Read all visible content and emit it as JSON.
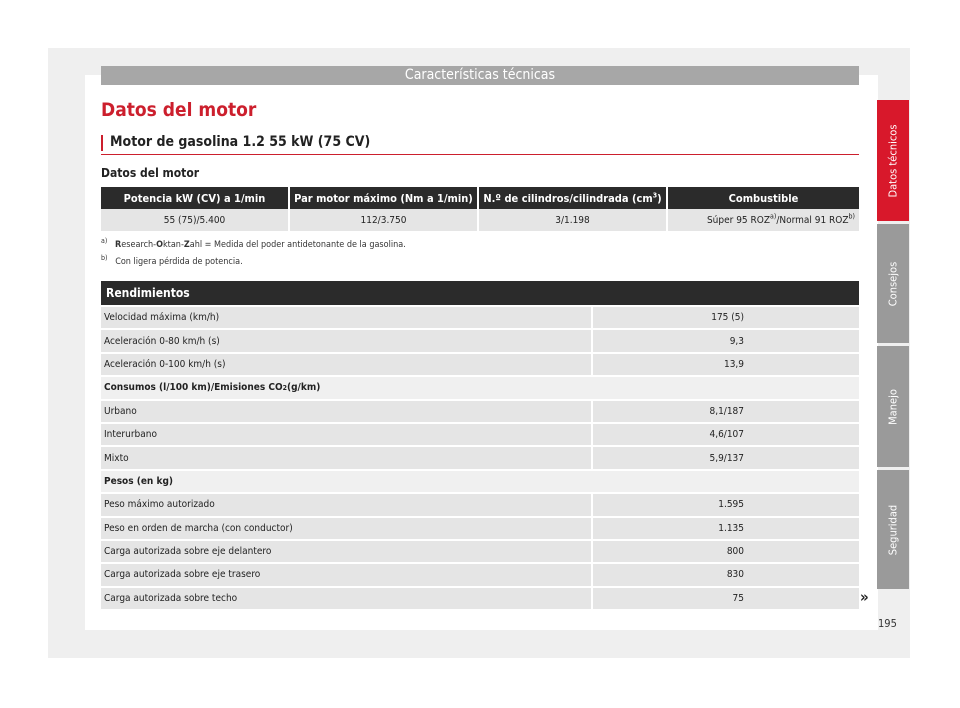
{
  "header": {
    "title": "Características técnicas"
  },
  "section_title": "Datos del motor",
  "subsection_title": "Motor de gasolina 1.2 55 kW (75 CV)",
  "engine_label": "Datos del motor",
  "engine_table": {
    "headers": [
      "Potencia kW (CV) a 1/min",
      "Par motor máximo (Nm a 1/min)",
      "N.º de cilindros/cilindrada (cm",
      "Combustible"
    ],
    "header_sup": "3",
    "header_close": ")",
    "row": [
      "55 (75)/5.400",
      "112/3.750",
      "3/1.198"
    ],
    "fuel_a": "Súper 95 ROZ",
    "fuel_a_sup": "a)",
    "fuel_b": "/Normal 91 ROZ",
    "fuel_b_sup": "b)"
  },
  "footnotes": [
    {
      "mark": "a)",
      "b1": "R",
      "t1": "esearch-",
      "b2": "O",
      "t2": "ktan-",
      "b3": "Z",
      "t3": "ahl = Medida del poder antidetonante de la gasolina."
    },
    {
      "mark": "b)",
      "text": "Con ligera pérdida de potencia."
    }
  ],
  "performance": {
    "header": "Rendimientos",
    "rows": [
      {
        "label": "Velocidad máxima (km/h)",
        "value": "175 (5)"
      },
      {
        "label": "Aceleración 0-80 km/h (s)",
        "value": "9,3"
      },
      {
        "label": "Aceleración 0-100 km/h (s)",
        "value": "13,9"
      },
      {
        "label": "Consumos (l/100 km)/Emisiones CO",
        "sub": "2",
        "label_end": " (g/km)"
      },
      {
        "label": "Urbano",
        "value": "8,1/187"
      },
      {
        "label": "Interurbano",
        "value": "4,6/107"
      },
      {
        "label": "Mixto",
        "value": "5,9/137"
      },
      {
        "label": "Pesos (en kg)"
      },
      {
        "label": "Peso máximo autorizado",
        "value": "1.595"
      },
      {
        "label": "Peso en orden de marcha (con conductor)",
        "value": "1.135"
      },
      {
        "label": "Carga autorizada sobre eje delantero",
        "value": "800"
      },
      {
        "label": "Carga autorizada sobre eje trasero",
        "value": "830"
      },
      {
        "label": "Carga autorizada sobre techo",
        "value": "75"
      }
    ]
  },
  "side_tabs": [
    "Datos técnicos",
    "Consejos",
    "Manejo",
    "Seguridad"
  ],
  "continue_arrow": "»",
  "page_number": "195",
  "colors": {
    "accent": "#d8182b",
    "table_header": "#2b2b2b",
    "tab_inactive": "#9a9a9a",
    "cell": "#e5e5e5"
  }
}
